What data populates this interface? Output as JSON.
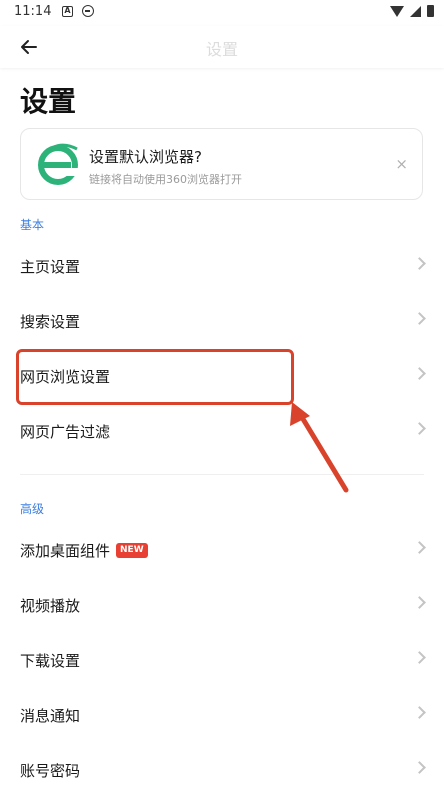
{
  "status_bar": {
    "time": "11:14",
    "icons": [
      "a-icon",
      "e-icon",
      "wifi-icon",
      "signal-icon",
      "battery-icon"
    ]
  },
  "top_bar": {
    "title": "设置",
    "back_icon": "arrow-left-icon"
  },
  "page_title": "设置",
  "promo": {
    "logo_icon": "360-browser-logo-icon",
    "title": "设置默认浏览器?",
    "subtitle": "链接将自动使用360浏览器打开",
    "close_symbol": "×"
  },
  "sections": [
    {
      "header": "基本",
      "items": [
        {
          "label": "主页设置"
        },
        {
          "label": "搜索设置"
        },
        {
          "label": "网页浏览设置"
        },
        {
          "label": "网页广告过滤"
        }
      ]
    },
    {
      "header": "高级",
      "items": [
        {
          "label": "添加桌面组件",
          "badge": "NEW"
        },
        {
          "label": "视频播放"
        },
        {
          "label": "下载设置"
        },
        {
          "label": "消息通知"
        },
        {
          "label": "账号密码"
        }
      ]
    }
  ],
  "colors": {
    "accent": "#3d7fe0",
    "highlight": "#d9432b",
    "badge": "#e84033",
    "logo": "#2db37a"
  }
}
